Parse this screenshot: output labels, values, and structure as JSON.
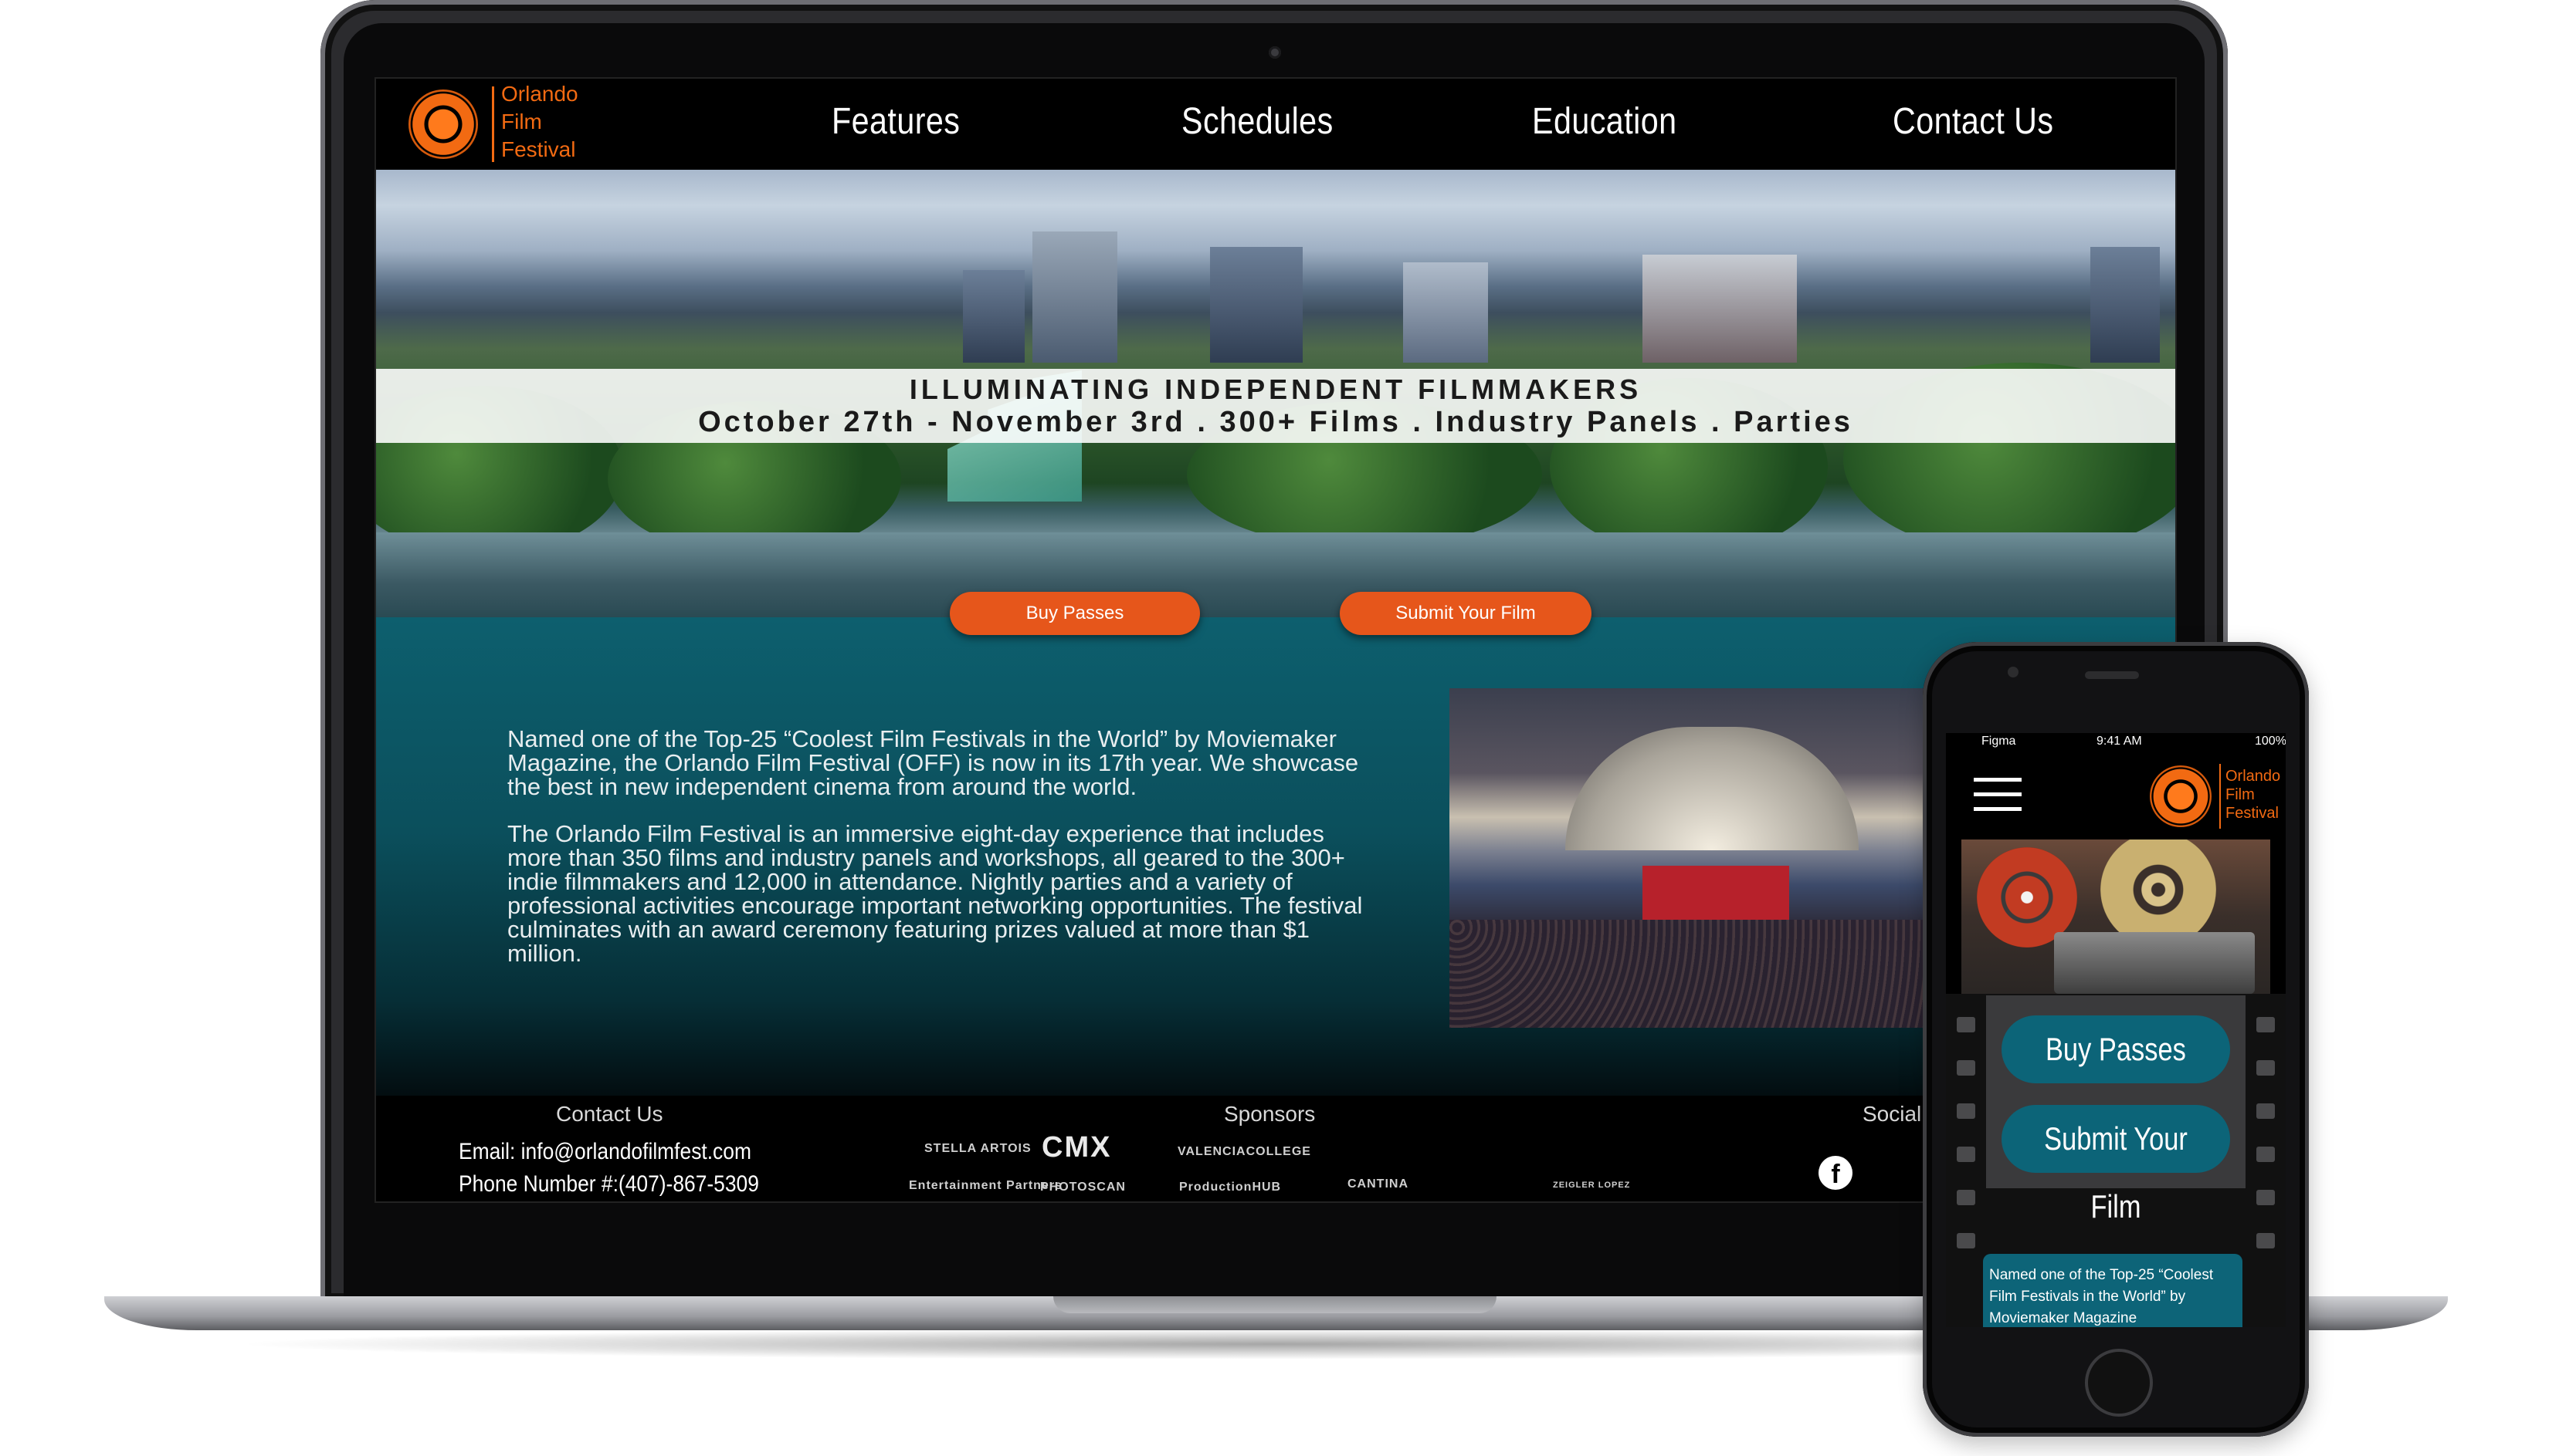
{
  "site": {
    "logo": {
      "line1": "Orlando",
      "line2": "Film",
      "line3": "Festival"
    },
    "nav": [
      {
        "label": "Features"
      },
      {
        "label": "Schedules"
      },
      {
        "label": "Education"
      },
      {
        "label": "Contact Us"
      }
    ],
    "banner": {
      "line1": "ILLUMINATING INDEPENDENT FILMMAKERS",
      "line2": "October 27th - November 3rd . 300+ Films . Industry Panels . Parties"
    },
    "cta": {
      "buy": "Buy Passes",
      "submit": "Submit Your Film"
    },
    "about": {
      "p1": "Named one of the Top-25 “Coolest Film Festivals in the World” by Moviemaker Magazine, the Orlando Film Festival (OFF) is now in its 17th year. We showcase the best in new independent cinema from around the world.",
      "p2": "The Orlando Film Festival is an immersive eight-day experience that includes more than 350 films and industry panels and workshops, all geared to the 300+ indie filmmakers and 12,000 in attendance. Nightly parties and a variety of professional activities encourage important networking opportunities. The festival culminates with an award ceremony featuring prizes valued at more than $1 million."
    },
    "footer": {
      "contact_heading": "Contact Us",
      "email": "Email: info@orlandofilmfest.com",
      "phone": "Phone Number #:(407)-867-5309",
      "sponsors_heading": "Sponsors",
      "social_heading": "Social",
      "sponsors": [
        "STELLA ARTOIS",
        "CMX",
        "VALENCIACOLLEGE",
        "Entertainment Partners",
        "PHOTOSCAN",
        "ProductionHUB",
        "CANTINA",
        "ZEIGLER LOPEZ"
      ]
    }
  },
  "mobile": {
    "status": {
      "carrier": "Figma",
      "time": "9:41 AM",
      "battery": "100%"
    },
    "logo": {
      "line1": "Orlando",
      "line2": "Film",
      "line3": "Festival"
    },
    "buttons": {
      "buy": "Buy Passes",
      "submit": "Submit Your Film"
    },
    "about_snippet": "Named one of the Top-25 “Coolest Film Festivals in the World” by Moviemaker Magazine"
  },
  "colors": {
    "accent": "#e6561b",
    "logo_orange": "#f26a12",
    "teal": "#0c6478",
    "nav_bg": "#000000"
  },
  "icons": [
    "facebook-icon",
    "twitter-icon",
    "hamburger-menu-icon",
    "orange-laurel-logo-icon"
  ]
}
